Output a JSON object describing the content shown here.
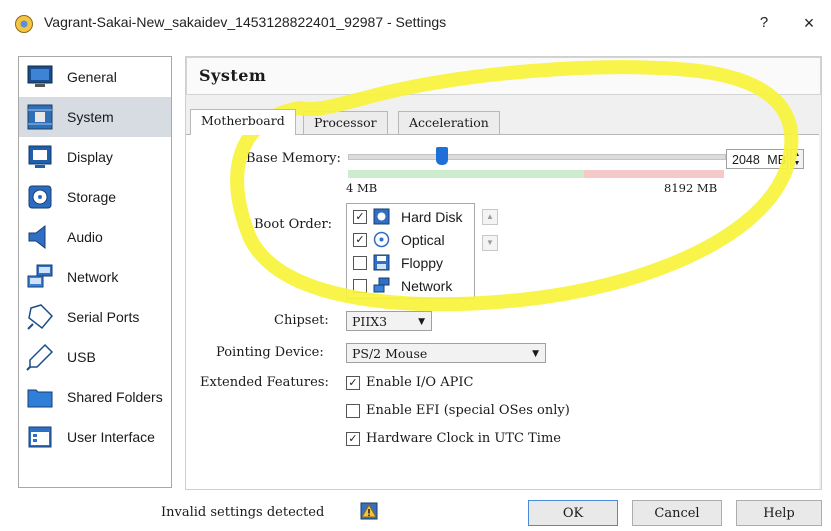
{
  "window": {
    "title": "Vagrant-Sakai-New_sakaidev_1453128822401_92987 - Settings",
    "help_label": "?",
    "close_label": "×"
  },
  "sidebar": {
    "items": [
      {
        "label": "General",
        "icon": "monitor-icon",
        "selected": false
      },
      {
        "label": "System",
        "icon": "chip-board-icon",
        "selected": true
      },
      {
        "label": "Display",
        "icon": "display-icon",
        "selected": false
      },
      {
        "label": "Storage",
        "icon": "storage-disc-icon",
        "selected": false
      },
      {
        "label": "Audio",
        "icon": "speaker-icon",
        "selected": false
      },
      {
        "label": "Network",
        "icon": "network-icon",
        "selected": false
      },
      {
        "label": "Serial Ports",
        "icon": "serial-plug-icon",
        "selected": false
      },
      {
        "label": "USB",
        "icon": "usb-icon",
        "selected": false
      },
      {
        "label": "Shared Folders",
        "icon": "folder-icon",
        "selected": false
      },
      {
        "label": "User Interface",
        "icon": "window-ui-icon",
        "selected": false
      }
    ]
  },
  "main": {
    "title": "System",
    "tabs": [
      {
        "label": "Motherboard",
        "active": true
      },
      {
        "label": "Processor",
        "active": false
      },
      {
        "label": "Acceleration",
        "active": false
      }
    ],
    "base_memory": {
      "label": "Base Memory:",
      "value": "2048",
      "unit": "MB",
      "min_label": "4 MB",
      "max_label": "8192 MB",
      "value_mb": 2048,
      "min_mb": 4,
      "max_mb": 8192
    },
    "boot_order": {
      "label": "Boot Order:",
      "items": [
        {
          "label": "Hard Disk",
          "checked": true,
          "icon": "hard-disk-icon"
        },
        {
          "label": "Optical",
          "checked": true,
          "icon": "optical-disc-icon"
        },
        {
          "label": "Floppy",
          "checked": false,
          "icon": "floppy-icon"
        },
        {
          "label": "Network",
          "checked": false,
          "icon": "network-icon"
        }
      ],
      "move_up": "▲",
      "move_down": "▼"
    },
    "chipset": {
      "label": "Chipset:",
      "value": "PIIX3"
    },
    "pointing_device": {
      "label": "Pointing Device:",
      "value": "PS/2 Mouse"
    },
    "extended_features": {
      "label": "Extended Features:",
      "items": [
        {
          "label": "Enable I/O APIC",
          "checked": true
        },
        {
          "label": "Enable EFI (special OSes only)",
          "checked": false
        },
        {
          "label": "Hardware Clock in UTC Time",
          "checked": true
        }
      ]
    }
  },
  "footer": {
    "status": "Invalid settings detected",
    "ok_label": "OK",
    "cancel_label": "Cancel",
    "help_label": "Help"
  },
  "colors": {
    "annotation": "#f7f33a",
    "selected_bg": "#d7dbe2",
    "slider_handle": "#1f6fd6"
  }
}
